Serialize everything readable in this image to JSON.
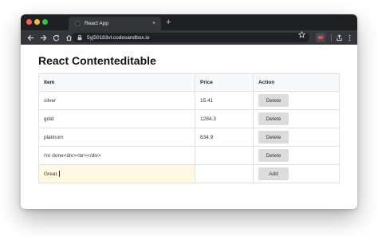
{
  "browser": {
    "tab_title": "React App",
    "tab_close": "×",
    "new_tab": "+",
    "url": "5yj50183vl.codesandbox.io"
  },
  "page": {
    "title": "React Contenteditable",
    "columns": [
      "Item",
      "Price",
      "Action"
    ],
    "rows": [
      {
        "item": "silver",
        "price": "15.41",
        "action": "Delete"
      },
      {
        "item": "gold",
        "price": "1284.3",
        "action": "Delete"
      },
      {
        "item": "platinum",
        "price": "834.9",
        "action": "Delete"
      },
      {
        "item": "I'm done<div><br></div>",
        "price": "",
        "action": "Delete"
      }
    ],
    "new_row": {
      "item": "Great.",
      "price": "",
      "action": "Add"
    }
  },
  "colors": {
    "tabbar": "#1f2022",
    "toolbar": "#35363a",
    "editable_highlight": "#fff9e3",
    "button_bg": "#dcdcdc"
  },
  "icons": [
    "back-arrow-icon",
    "forward-arrow-icon",
    "reload-icon",
    "home-icon",
    "lock-icon",
    "star-icon",
    "extension-icon",
    "share-icon",
    "menu-icon"
  ]
}
